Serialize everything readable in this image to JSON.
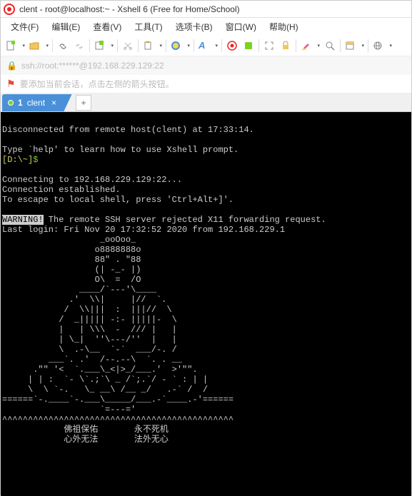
{
  "window": {
    "title": "clent - root@localhost:~ - Xshell 6 (Free for Home/School)"
  },
  "menus": {
    "file": "文件(F)",
    "edit": "编辑(E)",
    "view": "查看(V)",
    "tools": "工具(T)",
    "tabs": "选项卡(B)",
    "window": "窗口(W)",
    "help": "帮助(H)"
  },
  "address": {
    "text": "ssh://root:******@192.168.229.129:22"
  },
  "hint": {
    "text": "要添加当前会话，点击左侧的箭头按钮。"
  },
  "tab": {
    "index": "1",
    "label": "clent"
  },
  "terminal": {
    "blank1": "",
    "disconnected": "Disconnected from remote host(clent) at 17:33:14.",
    "blank2": "",
    "helpline": "Type `help' to learn how to use Xshell prompt.",
    "prompt_pre": "[D:\\~]",
    "prompt_dollar": "$",
    "blank3": "",
    "connecting": "Connecting to 192.168.229.129:22...",
    "established": "Connection established.",
    "escape": "To escape to local shell, press 'Ctrl+Alt+]'.",
    "blank4": "",
    "warning_label": "WARNING!",
    "warning_rest": " The remote SSH server rejected X11 forwarding request.",
    "lastlogin": "Last login: Fri Nov 20 17:32:52 2020 from 192.168.229.1",
    "art01": "                   _ooOoo_",
    "art02": "                  o8888888o",
    "art03": "                  88\" . \"88",
    "art04": "                  (| -_- |)",
    "art05": "                  O\\  =  /O",
    "art06": "               ____/`---'\\____",
    "art07": "             .'  \\\\|     |//  `.",
    "art08": "            /  \\\\|||  :  |||//  \\",
    "art09": "           /  _||||| -:- |||||-  \\",
    "art10": "           |   | \\\\\\  -  /// |   |",
    "art11": "           | \\_|  ''\\---/''  |   |",
    "art12": "           \\  .-\\__  `-`  ___/-. /",
    "art13": "         ___`. .'  /--.--\\  `. . __",
    "art14": "      .\"\" '<  `.___\\_<|>_/___.'  >'\"\".",
    "art15": "     | | :  `- \\`.;`\\ _ /`;.`/ - ` : | |",
    "art16": "     \\  \\ `-.   \\_ __\\ /__ _/   .-` /  /",
    "art17": "======`-.____`-.___\\_____/___.-`____.-'======",
    "art18": "                   `=---='",
    "art19": "^^^^^^^^^^^^^^^^^^^^^^^^^^^^^^^^^^^^^^^^^^^^^",
    "bless1": "            佛祖保佑       永不死机",
    "bless2": "            心外无法       法外无心"
  }
}
